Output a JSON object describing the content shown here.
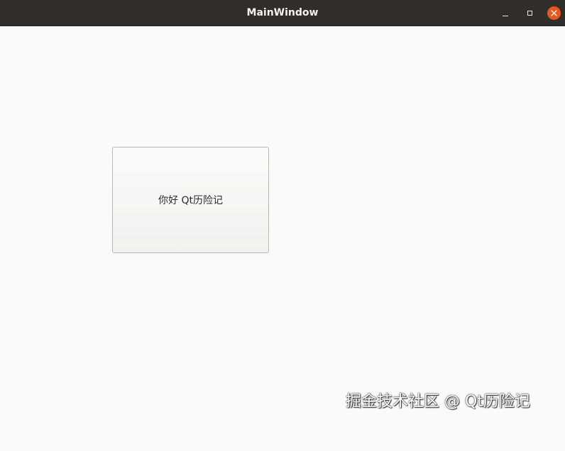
{
  "window": {
    "title": "MainWindow"
  },
  "controls": {
    "minimize_icon": "minimize-icon",
    "maximize_icon": "maximize-icon",
    "close_icon": "close-icon",
    "close_color": "#e95420"
  },
  "main": {
    "push_button_label": "你好 Qt历险记"
  },
  "watermark": {
    "text": "掘金技术社区 @ Qt历险记"
  },
  "colors": {
    "titlebar": "#2f2e2b",
    "background": "#fafafa"
  }
}
